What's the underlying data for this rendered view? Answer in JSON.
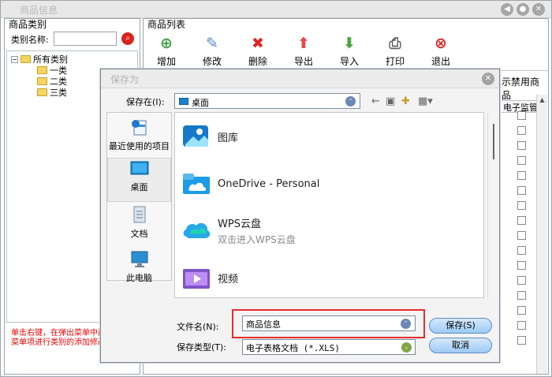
{
  "app": {
    "title": "商品信息",
    "window_buttons": [
      "◀",
      "●",
      "✕"
    ]
  },
  "left_panel": {
    "header": "商品类别",
    "search_label": "类别名称:",
    "tree": [
      {
        "label": "所有类别",
        "toggle": "−"
      },
      {
        "label": "一类"
      },
      {
        "label": "二类"
      },
      {
        "label": "三类"
      }
    ],
    "note": "单击右键，在弹出菜单中间菜单项进行类别的添加修改"
  },
  "right_panel": {
    "header": "商品列表",
    "toolbar": [
      {
        "label": "增加",
        "icon": "add-icon"
      },
      {
        "label": "修改",
        "icon": "edit-icon"
      },
      {
        "label": "删除",
        "icon": "delete-icon"
      },
      {
        "label": "导出",
        "icon": "export-icon"
      },
      {
        "label": "导入",
        "icon": "import-icon"
      },
      {
        "label": "打印",
        "icon": "printer-icon"
      },
      {
        "label": "退出",
        "icon": "exit-icon"
      }
    ],
    "disabled_filter_fragment": "示禁用商品",
    "column_fragment": "电子监管"
  },
  "dialog": {
    "title": "保存为",
    "location_label": "保存在(I):",
    "location_value": "桌面",
    "places": [
      {
        "label": "最近使用的项目"
      },
      {
        "label": "桌面"
      },
      {
        "label": "文档"
      },
      {
        "label": "此电脑"
      }
    ],
    "files": [
      {
        "name": "图库"
      },
      {
        "name": "OneDrive - Personal"
      },
      {
        "name": "WPS云盘",
        "subtitle": "双击进入WPS云盘"
      },
      {
        "name": "视频"
      }
    ],
    "filename_label": "文件名(N):",
    "filename_value": "商品信息",
    "filetype_label": "保存类型(T):",
    "filetype_value": "电子表格文档 (*.XLS)",
    "save_button": "保存(S)",
    "cancel_button": "取消"
  }
}
